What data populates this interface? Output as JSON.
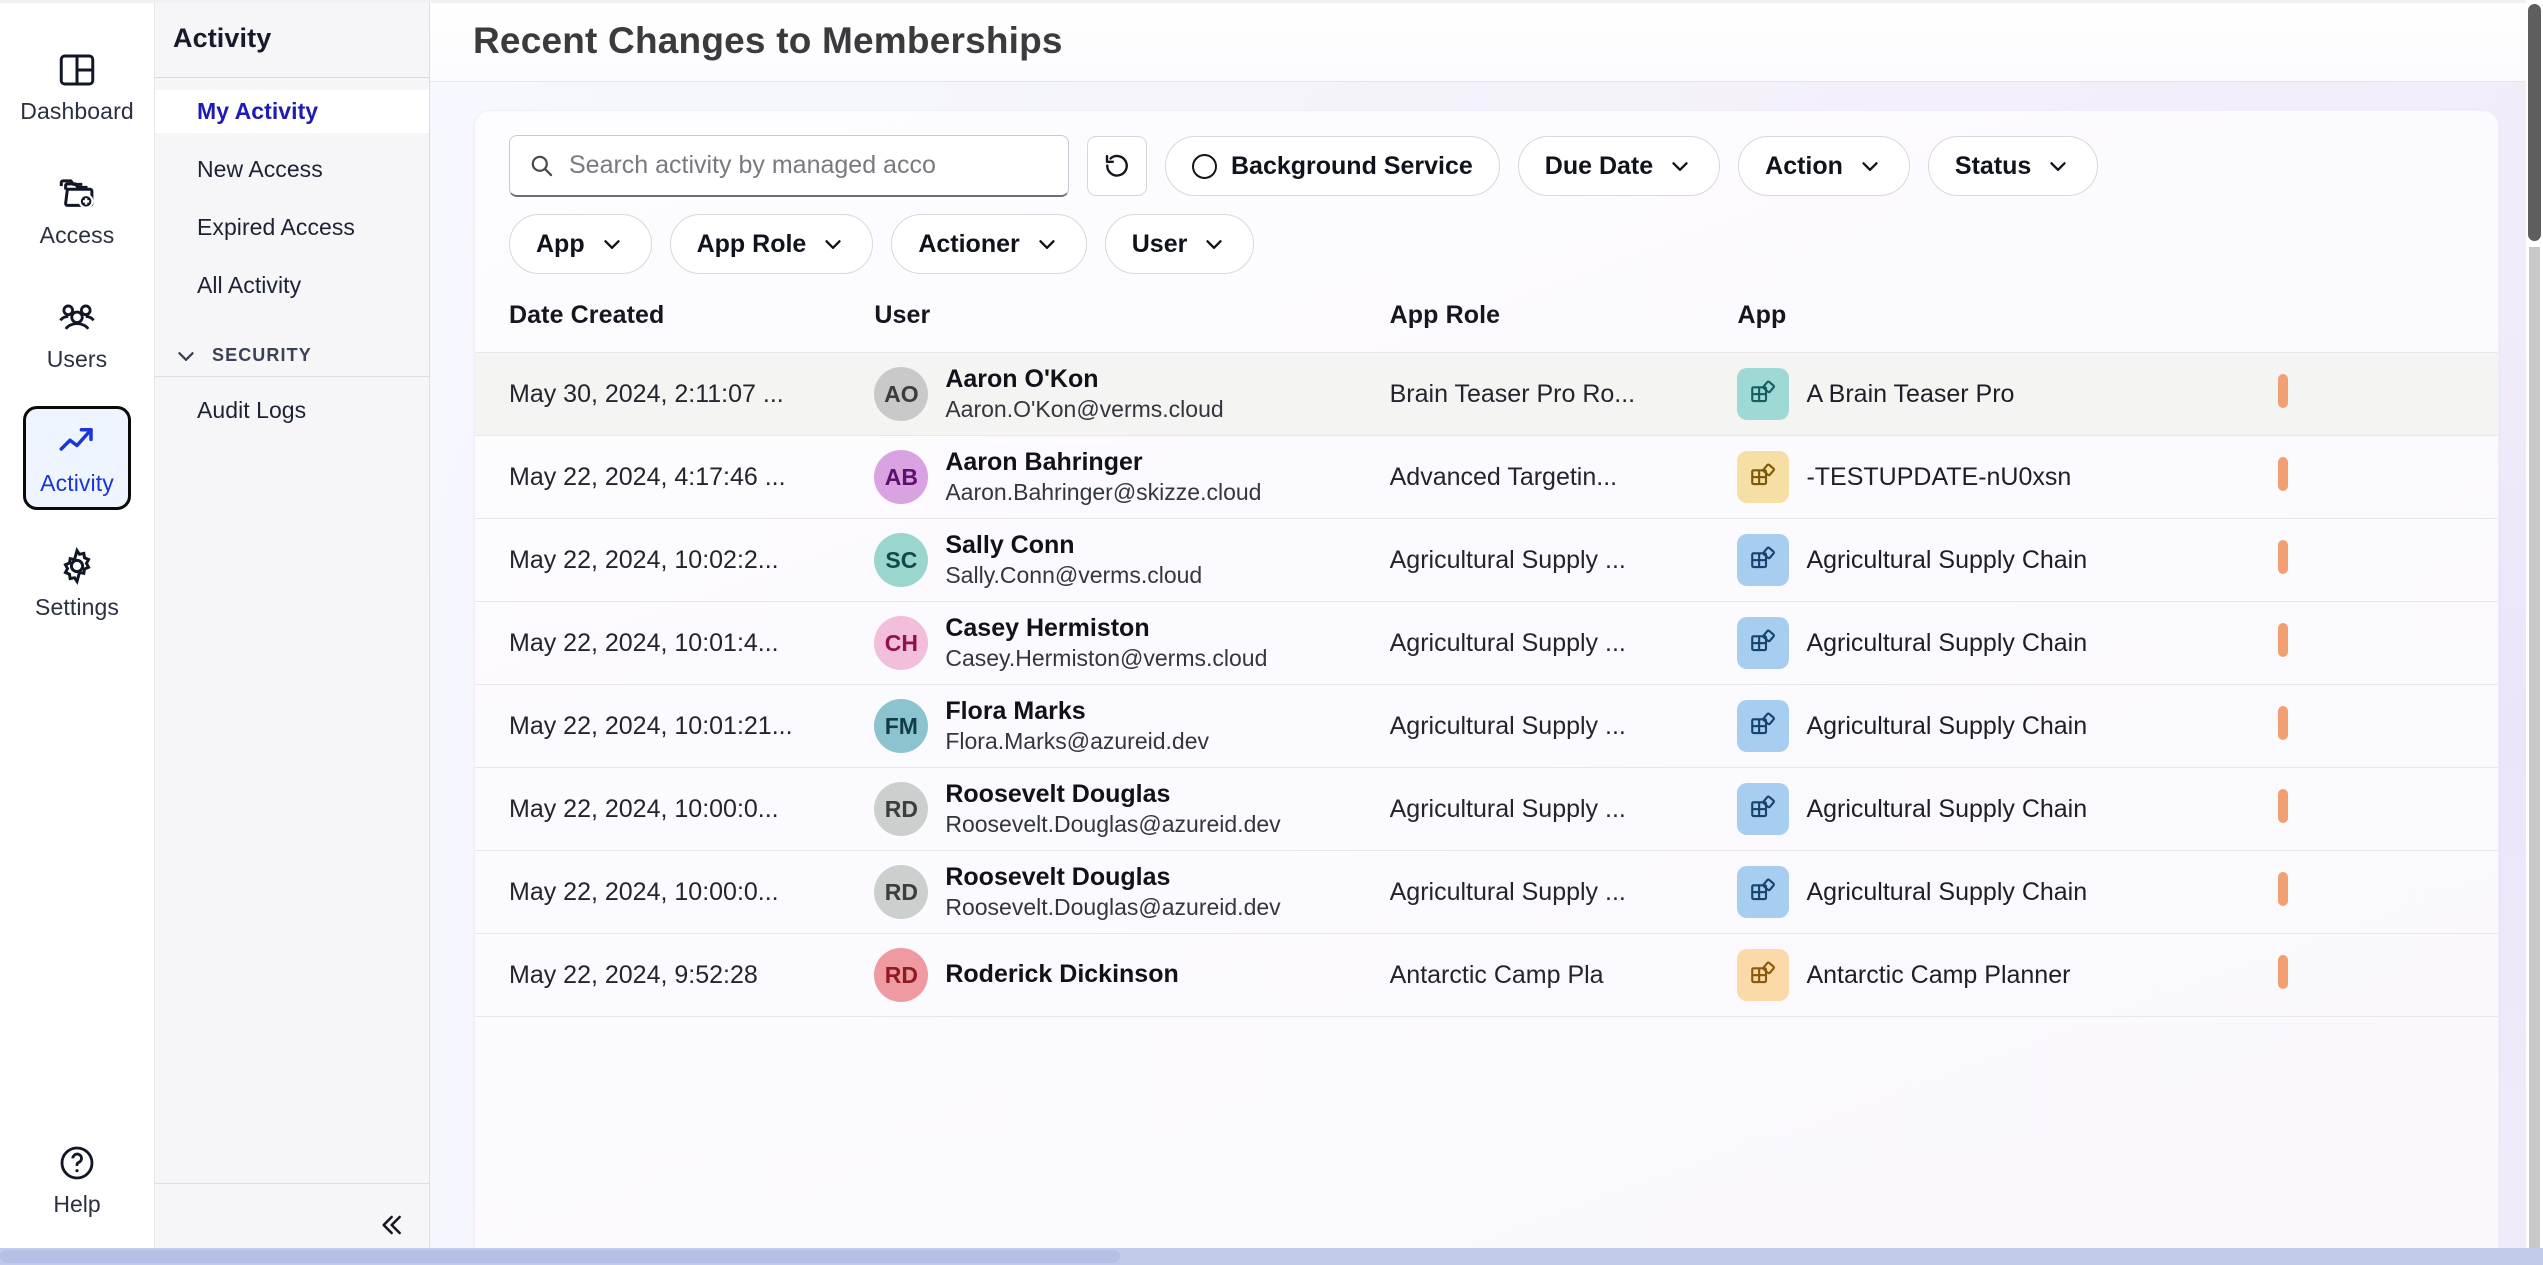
{
  "rail": {
    "items": [
      {
        "label": "Dashboard",
        "icon": "dashboard-icon",
        "active": false
      },
      {
        "label": "Access",
        "icon": "access-folder-plus-icon",
        "active": false
      },
      {
        "label": "Users",
        "icon": "users-group-icon",
        "active": false
      },
      {
        "label": "Activity",
        "icon": "activity-trend-icon",
        "active": true
      },
      {
        "label": "Settings",
        "icon": "gear-icon",
        "active": false
      }
    ],
    "help": {
      "label": "Help",
      "icon": "help-circle-icon"
    }
  },
  "subnav": {
    "title": "Activity",
    "items": [
      {
        "label": "My Activity",
        "current": true
      },
      {
        "label": "New Access",
        "current": false
      },
      {
        "label": "Expired Access",
        "current": false
      },
      {
        "label": "All Activity",
        "current": false
      }
    ],
    "group": {
      "label": "SECURITY",
      "expanded": true,
      "icon": "chevron-down-icon"
    },
    "group_items": [
      {
        "label": "Audit Logs",
        "current": false
      }
    ],
    "collapse": {
      "icon": "chevron-double-left-icon"
    }
  },
  "header": {
    "title": "Recent Changes to Memberships"
  },
  "filters": {
    "search": {
      "placeholder": "Search activity by managed acco",
      "value": "",
      "icon": "search-icon"
    },
    "refresh": {
      "icon": "refresh-ccw-icon",
      "label": ""
    },
    "chips": [
      {
        "label": "Background Service",
        "type": "toggle",
        "icon": "radio-unchecked-icon"
      },
      {
        "label": "Due Date",
        "type": "dropdown",
        "icon": "chevron-down-icon"
      },
      {
        "label": "Action",
        "type": "dropdown",
        "icon": "chevron-down-icon"
      },
      {
        "label": "Status",
        "type": "dropdown",
        "icon": "chevron-down-icon"
      }
    ],
    "chips_row2": [
      {
        "label": "App",
        "type": "dropdown",
        "icon": "chevron-down-icon"
      },
      {
        "label": "App Role",
        "type": "dropdown",
        "icon": "chevron-down-icon"
      },
      {
        "label": "Actioner",
        "type": "dropdown",
        "icon": "chevron-down-icon"
      },
      {
        "label": "User",
        "type": "dropdown",
        "icon": "chevron-down-icon"
      }
    ]
  },
  "table": {
    "columns": [
      "Date Created",
      "User",
      "App Role",
      "App",
      ""
    ],
    "rows": [
      {
        "date": "May 30, 2024, 2:11:07 ...",
        "user_name": "Aaron O'Kon",
        "user_email": "Aaron.O'Kon@verms.cloud",
        "initials": "AO",
        "avatar_bg": "#c9c9c9",
        "avatar_fg": "#3c3c3c",
        "role": "Brain Teaser Pro Ro...",
        "app": "A Brain Teaser Pro",
        "app_icon_bg": "#9ed9d6",
        "app_icon_fg": "#155e62",
        "highlighted": true
      },
      {
        "date": "May 22, 2024, 4:17:46 ...",
        "user_name": "Aaron Bahringer",
        "user_email": "Aaron.Bahringer@skizze.cloud",
        "initials": "AB",
        "avatar_bg": "#d8a3e0",
        "avatar_fg": "#5e1070",
        "role": "Advanced Targetin...",
        "app": "-TESTUPDATE-nU0xsn",
        "app_icon_bg": "#f6dfa4",
        "app_icon_fg": "#7a5a06",
        "highlighted": false
      },
      {
        "date": "May 22, 2024, 10:02:2...",
        "user_name": "Sally Conn",
        "user_email": "Sally.Conn@verms.cloud",
        "initials": "SC",
        "avatar_bg": "#9ad6ce",
        "avatar_fg": "#14484a",
        "role": "Agricultural Supply ...",
        "app": "Agricultural Supply Chain",
        "app_icon_bg": "#a7cdf0",
        "app_icon_fg": "#17436e",
        "highlighted": false
      },
      {
        "date": "May 22, 2024, 10:01:4...",
        "user_name": "Casey Hermiston",
        "user_email": "Casey.Hermiston@verms.cloud",
        "initials": "CH",
        "avatar_bg": "#f3bed9",
        "avatar_fg": "#8d1348",
        "role": "Agricultural Supply ...",
        "app": "Agricultural Supply Chain",
        "app_icon_bg": "#a7cdf0",
        "app_icon_fg": "#17436e",
        "highlighted": false
      },
      {
        "date": "May 22, 2024, 10:01:21...",
        "user_name": "Flora Marks",
        "user_email": "Flora.Marks@azureid.dev",
        "initials": "FM",
        "avatar_bg": "#8bc4ce",
        "avatar_fg": "#123c46",
        "role": "Agricultural Supply ...",
        "app": "Agricultural Supply Chain",
        "app_icon_bg": "#a7cdf0",
        "app_icon_fg": "#17436e",
        "highlighted": false
      },
      {
        "date": "May 22, 2024, 10:00:0...",
        "user_name": "Roosevelt Douglas",
        "user_email": "Roosevelt.Douglas@azureid.dev",
        "initials": "RD",
        "avatar_bg": "#cbd0ce",
        "avatar_fg": "#3a3f3d",
        "role": "Agricultural Supply ...",
        "app": "Agricultural Supply Chain",
        "app_icon_bg": "#a7cdf0",
        "app_icon_fg": "#17436e",
        "highlighted": false
      },
      {
        "date": "May 22, 2024, 10:00:0...",
        "user_name": "Roosevelt Douglas",
        "user_email": "Roosevelt.Douglas@azureid.dev",
        "initials": "RD",
        "avatar_bg": "#cbd0ce",
        "avatar_fg": "#3a3f3d",
        "role": "Agricultural Supply ...",
        "app": "Agricultural Supply Chain",
        "app_icon_bg": "#a7cdf0",
        "app_icon_fg": "#17436e",
        "highlighted": false
      },
      {
        "date": "May 22, 2024, 9:52:28",
        "user_name": "Roderick Dickinson",
        "user_email": "",
        "initials": "RD",
        "avatar_bg": "#ef9aa0",
        "avatar_fg": "#8e1b24",
        "role": "Antarctic Camp Pla",
        "app": "Antarctic Camp Planner",
        "app_icon_bg": "#fbd9a8",
        "app_icon_fg": "#8a5a07",
        "highlighted": false
      }
    ]
  },
  "scrollbars": {
    "vertical": {
      "position": "right"
    },
    "horizontal": {
      "position": "bottom"
    }
  }
}
